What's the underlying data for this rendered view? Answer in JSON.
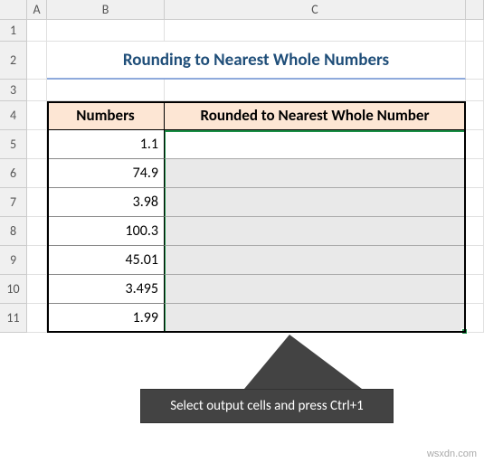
{
  "columns": [
    "A",
    "B",
    "C"
  ],
  "rows": [
    "1",
    "2",
    "3",
    "4",
    "5",
    "6",
    "7",
    "8",
    "9",
    "10",
    "11"
  ],
  "title": "Rounding to Nearest Whole Numbers",
  "headers": {
    "numbers": "Numbers",
    "rounded": "Rounded to Nearest Whole Number"
  },
  "values": [
    "1.1",
    "74.9",
    "3.98",
    "100.3",
    "45.01",
    "3.495",
    "1.99"
  ],
  "callout": "Select output cells and press Ctrl+1",
  "watermark": "wsxdn.com",
  "chart_data": {
    "type": "table",
    "title": "Rounding to Nearest Whole Numbers",
    "columns": [
      "Numbers",
      "Rounded to Nearest Whole Number"
    ],
    "rows": [
      [
        1.1,
        null
      ],
      [
        74.9,
        null
      ],
      [
        3.98,
        null
      ],
      [
        100.3,
        null
      ],
      [
        45.01,
        null
      ],
      [
        3.495,
        null
      ],
      [
        1.99,
        null
      ]
    ]
  }
}
